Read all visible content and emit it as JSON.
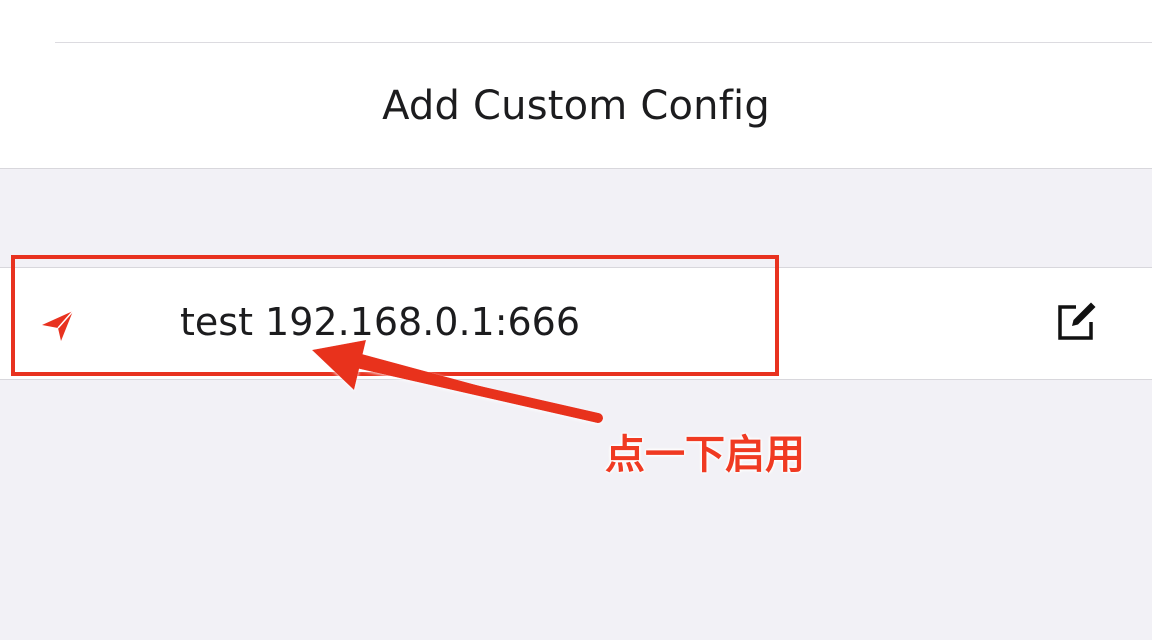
{
  "add_row": {
    "label": "Add Custom Config"
  },
  "config_row": {
    "label": "test 192.168.0.1:666",
    "status_icon": "paper-plane-icon",
    "edit_icon": "edit-icon"
  },
  "annotation": {
    "callout": "点一下启用",
    "color": "#e8321f"
  },
  "colors": {
    "accent": "#e8321f",
    "background": "#f2f1f6",
    "text": "#1c1c1e"
  }
}
